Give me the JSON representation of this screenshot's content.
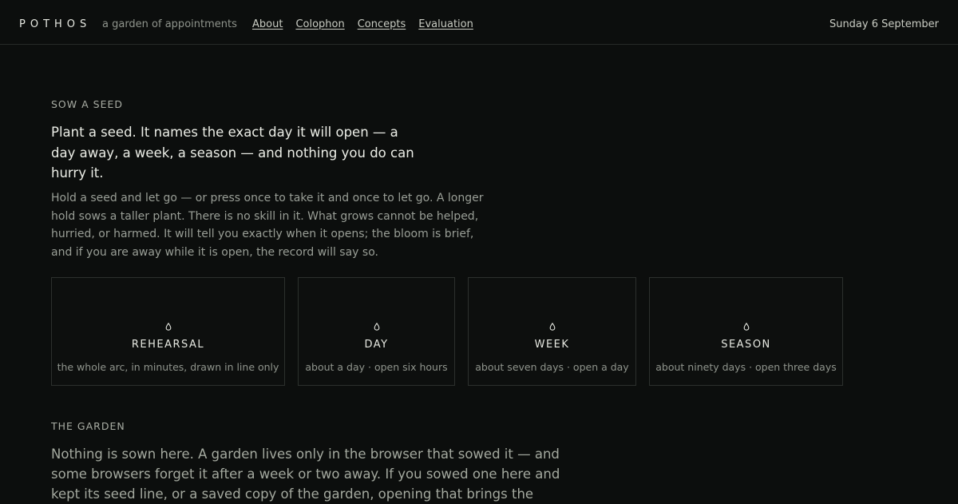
{
  "header": {
    "brand": "POTHOS",
    "tagline": "a garden of appointments",
    "nav": [
      "About",
      "Colophon",
      "Concepts",
      "Evaluation"
    ],
    "date": "Sunday 6 September"
  },
  "sow": {
    "label": "SOW A SEED",
    "lead": "Plant a seed. It names the exact day it will open — a day away, a week, a season — and nothing you do can hurry it.",
    "body": "Hold a seed and let go — or press once to take it and once to let go. A longer hold sows a taller plant. There is no skill in it. What grows cannot be helped, hurried, or harmed. It will tell you exactly when it opens; the bloom is brief, and if you are away while it is open, the record will say so."
  },
  "cards": [
    {
      "icon": "seed-icon",
      "title": "REHEARSAL",
      "sub": "the whole arc, in minutes, drawn in line only"
    },
    {
      "icon": "seed-icon",
      "title": "DAY",
      "sub": "about a day · open six hours"
    },
    {
      "icon": "seed-icon",
      "title": "WEEK",
      "sub": "about seven days · open a day"
    },
    {
      "icon": "seed-icon",
      "title": "SEASON",
      "sub": "about ninety days · open three days"
    }
  ],
  "garden": {
    "label": "THE GARDEN",
    "text": "Nothing is sown here. A garden lives only in the browser that sowed it — and some browsers forget it after a week or two away. If you sowed one here and kept its seed line, or a saved copy of the garden, opening that brings the"
  }
}
